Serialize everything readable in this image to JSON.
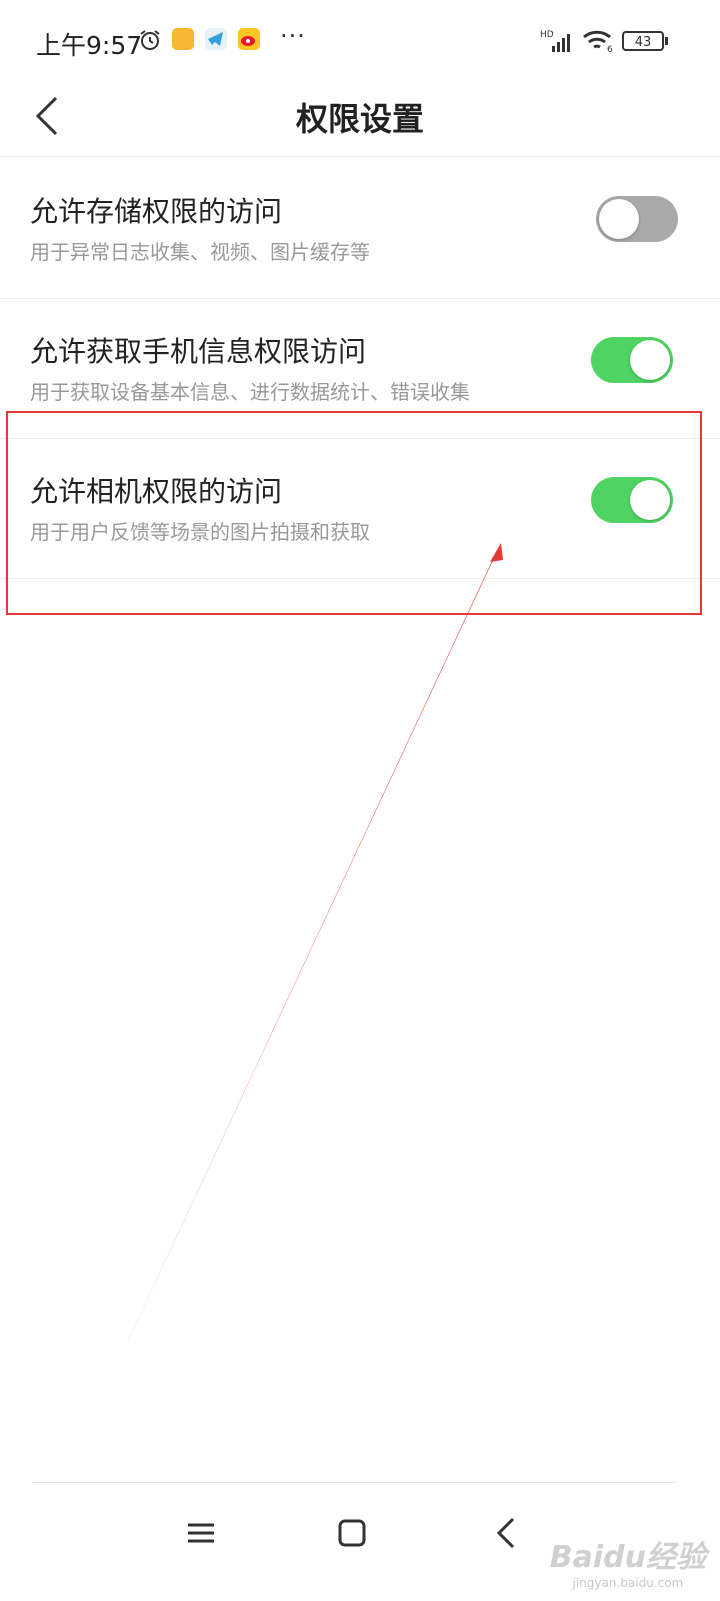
{
  "status_bar": {
    "time": "上午9:57",
    "more": "···",
    "network": "HD",
    "wifi_label": "6",
    "battery": "43",
    "icons": [
      "alarm-icon",
      "note-app-icon",
      "telegram-app-icon",
      "weibo-app-icon"
    ]
  },
  "header": {
    "title": "权限设置"
  },
  "settings": [
    {
      "title": "允许存储权限的访问",
      "description": "用于异常日志收集、视频、图片缓存等",
      "enabled": false
    },
    {
      "title": "允许获取手机信息权限访问",
      "description": "用于获取设备基本信息、进行数据统计、错误收集",
      "enabled": true
    },
    {
      "title": "允许相机权限的访问",
      "description": "用于用户反馈等场景的图片拍摄和获取",
      "enabled": true
    }
  ],
  "watermark": {
    "logo": "Baidu经验",
    "url": "jingyan.baidu.com"
  },
  "colors": {
    "toggle_on": "#4fd464",
    "toggle_off": "#a9a9a9",
    "annotation": "#e53935"
  }
}
